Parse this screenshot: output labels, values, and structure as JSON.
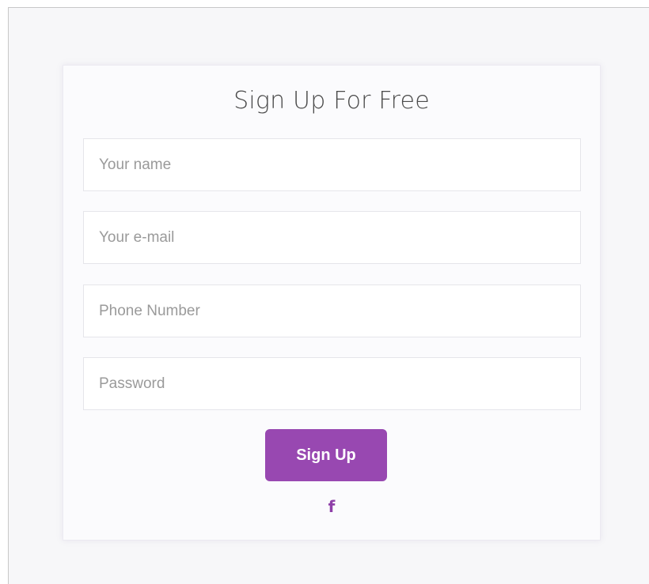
{
  "form": {
    "title": "Sign Up For Free",
    "fields": [
      {
        "placeholder": "Your name"
      },
      {
        "placeholder": "Your e-mail"
      },
      {
        "placeholder": "Phone Number"
      },
      {
        "placeholder": "Password"
      }
    ],
    "submit_label": "Sign Up",
    "social_icon": "facebook-icon",
    "social_glyph": "f"
  },
  "colors": {
    "accent": "#9848b1",
    "icon": "#8e3fa8",
    "background": "#f7f7f9"
  }
}
